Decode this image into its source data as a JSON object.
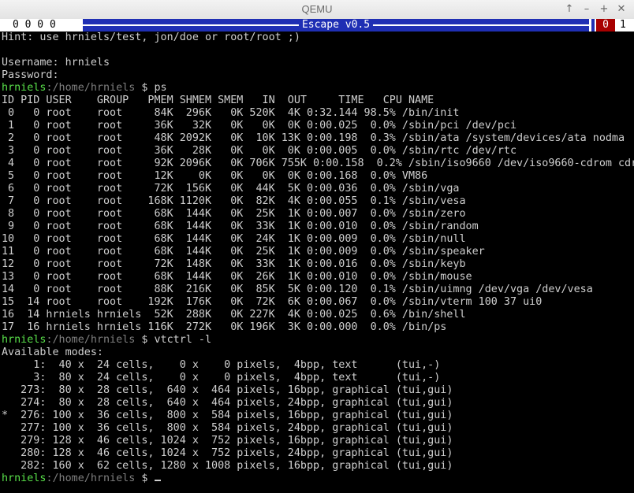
{
  "window": {
    "title": "QEMU",
    "buttons": [
      "↑",
      "–",
      "+",
      "✕"
    ]
  },
  "statusbar": {
    "left": "0 0 0 0",
    "center": "Escape v0.5",
    "right_badge": "0",
    "right_text": "1"
  },
  "terminal": {
    "hint": "Hint: use hrniels/test, jon/doe or root/root ;)",
    "blank": "",
    "username": "Username: hrniels",
    "password": "Password:",
    "prompt_user": "hrniels",
    "prompt_path": ":/home/hrniels",
    "prompt_sym": " $ ",
    "cmd1": "ps",
    "ps_header": "ID PID USER    GROUP   PMEM SHMEM SMEM   IN  OUT     TIME   CPU NAME",
    "ps_rows": [
      " 0   0 root    root     84K  296K   0K 520K  4K 0:32.144 98.5% /bin/init",
      " 1   0 root    root     36K   32K   0K   0K  0K 0:00.025  0.0% /sbin/pci /dev/pci",
      " 2   0 root    root     48K 2092K   0K  10K 13K 0:00.198  0.3% /sbin/ata /system/devices/ata nodma",
      " 3   0 root    root     36K   28K   0K   0K  0K 0:00.005  0.0% /sbin/rtc /dev/rtc",
      " 4   0 root    root     92K 2096K   0K 706K 755K 0:00.158  0.2% /sbin/iso9660 /dev/iso9660-cdrom cdr",
      " 5   0 root    root     12K    0K   0K   0K  0K 0:00.168  0.0% VM86",
      " 6   0 root    root     72K  156K   0K  44K  5K 0:00.036  0.0% /sbin/vga",
      " 7   0 root    root    168K 1120K   0K  82K  4K 0:00.055  0.1% /sbin/vesa",
      " 8   0 root    root     68K  144K   0K  25K  1K 0:00.007  0.0% /sbin/zero",
      " 9   0 root    root     68K  144K   0K  33K  1K 0:00.010  0.0% /sbin/random",
      "10   0 root    root     68K  144K   0K  24K  1K 0:00.009  0.0% /sbin/null",
      "11   0 root    root     68K  144K   0K  25K  1K 0:00.009  0.0% /sbin/speaker",
      "12   0 root    root     72K  148K   0K  33K  1K 0:00.016  0.0% /sbin/keyb",
      "13   0 root    root     68K  144K   0K  26K  1K 0:00.010  0.0% /sbin/mouse",
      "14   0 root    root     88K  216K   0K  85K  5K 0:00.120  0.1% /sbin/uimng /dev/vga /dev/vesa",
      "15  14 root    root    192K  176K   0K  72K  6K 0:00.067  0.0% /sbin/vterm 100 37 ui0",
      "16  14 hrniels hrniels  52K  288K   0K 227K  4K 0:00.025  0.6% /bin/shell",
      "17  16 hrniels hrniels 116K  272K   0K 196K  3K 0:00.000  0.0% /bin/ps"
    ],
    "cmd2": "vtctrl -l",
    "modes_header": "Available modes:",
    "modes": [
      "     1:  40 x  24 cells,    0 x    0 pixels,  4bpp, text      (tui,-)",
      "     3:  80 x  24 cells,    0 x    0 pixels,  4bpp, text      (tui,-)",
      "   273:  80 x  28 cells,  640 x  464 pixels, 16bpp, graphical (tui,gui)",
      "   274:  80 x  28 cells,  640 x  464 pixels, 24bpp, graphical (tui,gui)",
      "*  276: 100 x  36 cells,  800 x  584 pixels, 16bpp, graphical (tui,gui)",
      "   277: 100 x  36 cells,  800 x  584 pixels, 24bpp, graphical (tui,gui)",
      "   279: 128 x  46 cells, 1024 x  752 pixels, 16bpp, graphical (tui,gui)",
      "   280: 128 x  46 cells, 1024 x  752 pixels, 24bpp, graphical (tui,gui)",
      "   282: 160 x  62 cells, 1280 x 1008 pixels, 16bpp, graphical (tui,gui)"
    ]
  },
  "colors": {
    "prompt_user": "#59e04a",
    "prompt_path": "#7f7f7f",
    "text": "#cfcfcf",
    "statusbar_blue": "#1f2fb4",
    "badge_red": "#a80000"
  }
}
